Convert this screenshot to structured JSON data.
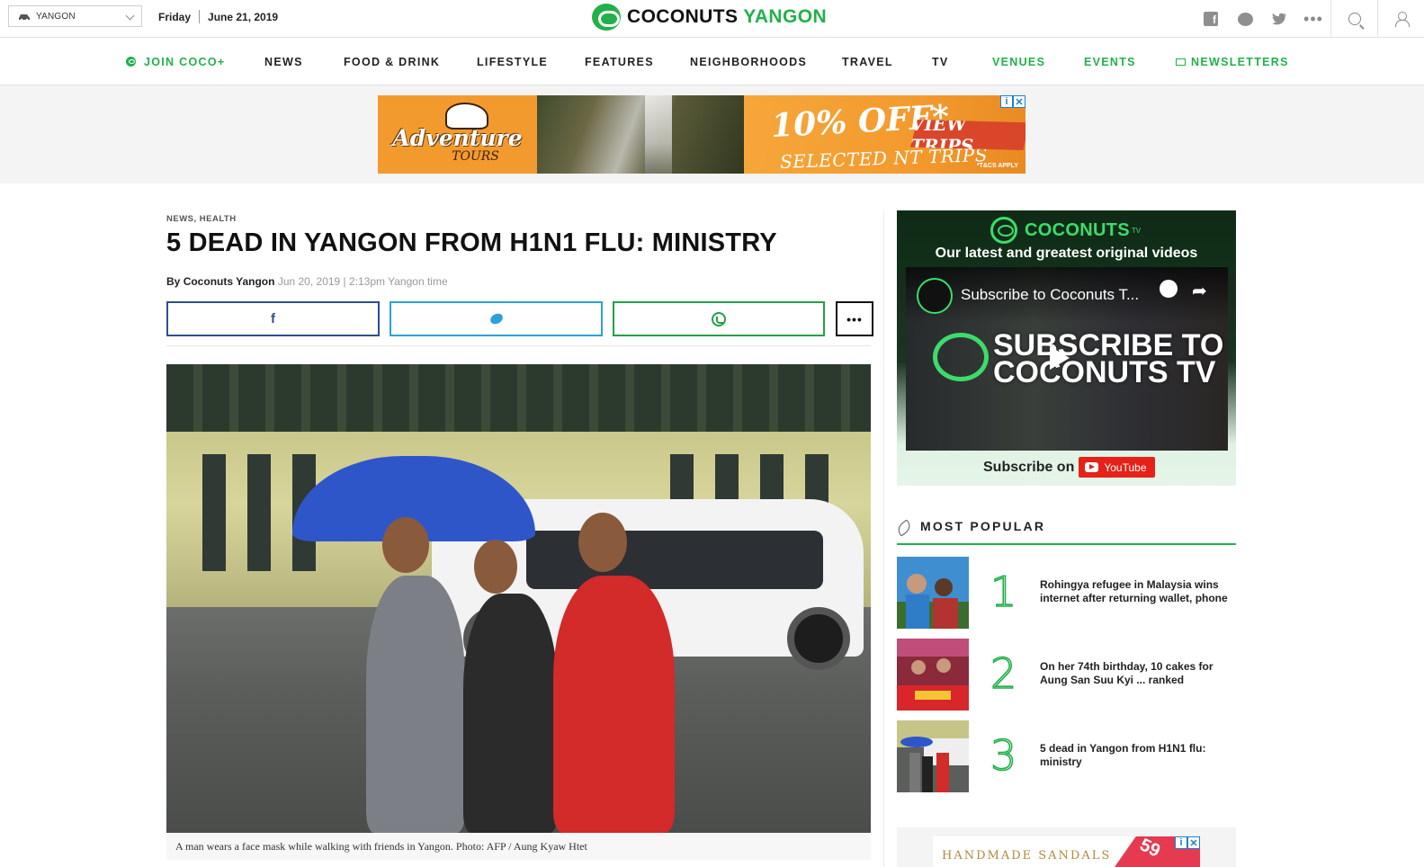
{
  "topbar": {
    "city": "YANGON",
    "day": "Friday",
    "date": "June 21, 2019",
    "logo_main": "COCONUTS",
    "logo_city": "YANGON",
    "icons": [
      "facebook-icon",
      "messenger-icon",
      "twitter-icon",
      "more-icon",
      "search-icon",
      "user-icon"
    ]
  },
  "nav": {
    "join": "JOIN COCO+",
    "items": [
      "NEWS",
      "FOOD & DRINK",
      "LIFESTYLE",
      "FEATURES",
      "NEIGHBORHOODS",
      "TRAVEL",
      "TV"
    ],
    "venues": "VENUES",
    "events": "EVENTS",
    "newsletters": "NEWSLETTERS"
  },
  "ad_top": {
    "brand_line1": "Adventure",
    "brand_line2": "TOURS",
    "offer": "10% OFF*",
    "sub": "SELECTED NT TRIPS",
    "cta": "VIEW TRIPS",
    "terms": "*T&CS APPLY"
  },
  "article": {
    "categories": "NEWS, HEALTH",
    "headline": "5 DEAD IN YANGON FROM H1N1 FLU: MINISTRY",
    "byline_prefix": "By",
    "author": "Coconuts Yangon",
    "timestamp": "Jun 20, 2019 | 2:13pm Yangon time",
    "share": {
      "facebook": "f",
      "more": "•••"
    },
    "caption": "A man wears a face mask while walking with friends in Yangon. Photo: AFP / Aung Kyaw Htet"
  },
  "sidebar": {
    "tv_brand": "COCONUTS",
    "tv_sup": "TV",
    "tv_tagline": "Our latest and greatest original videos",
    "video_title": "Subscribe to Coconuts T...",
    "video_overlay_line1": "SUBSCRIBE TO",
    "video_overlay_line2": "COCONUTS TV",
    "subscribe_label": "Subscribe on",
    "youtube_label": "YouTube",
    "most_popular_title": "MOST POPULAR",
    "most_popular": [
      {
        "rank": "1",
        "title": "Rohingya refugee in Malaysia wins internet after returning wallet, phone"
      },
      {
        "rank": "2",
        "title": "On her 74th birthday, 10 cakes for Aung San Suu Kyi ... ranked"
      },
      {
        "rank": "3",
        "title": "5 dead in Yangon from H1N1 flu: ministry"
      }
    ],
    "ad2_text": "HANDMADE SANDALS",
    "ad2_badge": "59"
  },
  "colors": {
    "brand_green": "#22b04b",
    "facebook": "#2f4e8f",
    "twitter": "#2aa1dc",
    "whatsapp": "#24a047"
  }
}
